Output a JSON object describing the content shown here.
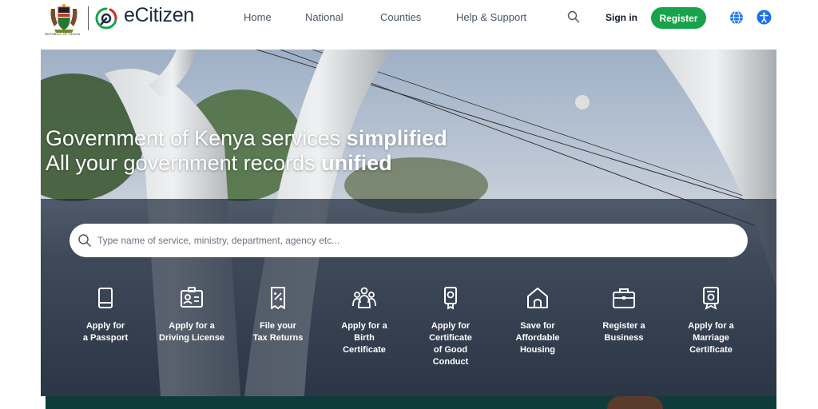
{
  "header": {
    "coat_caption": "REPUBLIC OF KENYA",
    "brand_name": "eCitizen",
    "nav": [
      "Home",
      "National",
      "Counties",
      "Help & Support"
    ],
    "signin_label": "Sign in",
    "register_label": "Register"
  },
  "hero": {
    "headline_1_light": "Government of Kenya services ",
    "headline_1_bold": "simplified",
    "headline_2_light": "All your government records ",
    "headline_2_bold": "unified",
    "search_placeholder": "Type name of service, ministry, department, agency etc..."
  },
  "services": [
    {
      "line1": "Apply for",
      "line2": "a Passport",
      "line3": "",
      "line4": ""
    },
    {
      "line1": "Apply for a",
      "line2": "Driving License",
      "line3": "",
      "line4": ""
    },
    {
      "line1": "File your",
      "line2": "Tax Returns",
      "line3": "",
      "line4": ""
    },
    {
      "line1": "Apply for a",
      "line2": "Birth",
      "line3": "Certificate",
      "line4": ""
    },
    {
      "line1": "Apply for",
      "line2": "Certificate",
      "line3": "of Good",
      "line4": "Conduct"
    },
    {
      "line1": "Save for",
      "line2": "Affordable",
      "line3": "Housing",
      "line4": ""
    },
    {
      "line1": "Register a",
      "line2": "Business",
      "line3": "",
      "line4": ""
    },
    {
      "line1": "Apply for a",
      "line2": "Marriage",
      "line3": "Certificate",
      "line4": ""
    }
  ],
  "icons": [
    "passport-icon",
    "id-card-icon",
    "tax-receipt-icon",
    "family-icon",
    "certificate-icon",
    "house-icon",
    "briefcase-icon",
    "marriage-certificate-icon"
  ],
  "colors": {
    "accent": "#17a34a",
    "brand_text": "#1f2a44",
    "overlay": "#1e293b",
    "accessibility": "#1a73e8"
  }
}
